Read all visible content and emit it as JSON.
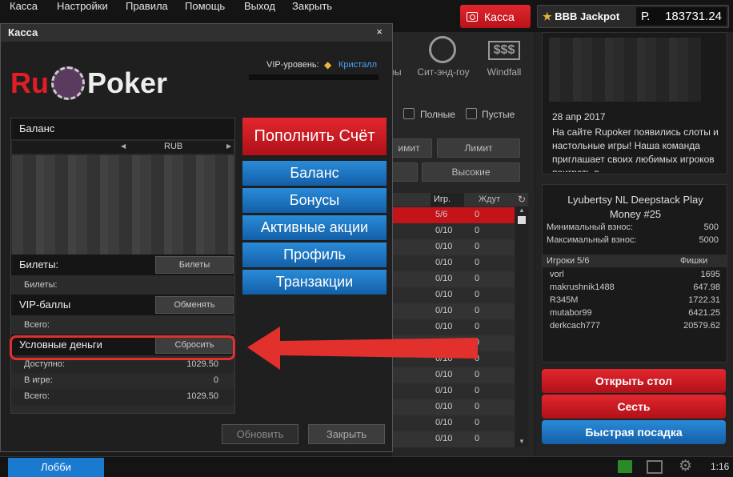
{
  "menu": [
    "Касса",
    "Настройки",
    "Правила",
    "Помощь",
    "Выход",
    "Закрыть"
  ],
  "cash_button": "Касса",
  "jackpot": {
    "title": "BBB Jackpot",
    "currency": "Р.",
    "value": "183731.24"
  },
  "game_tabs": [
    "ры",
    "Сит-энд-гоу",
    "Windfall"
  ],
  "filters": {
    "full": "Полные",
    "empty": "Пустые",
    "limit1": "имит",
    "limit2": "Лимит",
    "high": "Высокие"
  },
  "table_head": {
    "players": "Игр.",
    "waiting": "Ждут"
  },
  "table_rows": [
    {
      "players": "5/6",
      "wait": "0"
    },
    {
      "players": "0/10",
      "wait": "0"
    },
    {
      "players": "0/10",
      "wait": "0"
    },
    {
      "players": "0/10",
      "wait": "0"
    },
    {
      "players": "0/10",
      "wait": "0"
    },
    {
      "players": "0/10",
      "wait": "0"
    },
    {
      "players": "0/10",
      "wait": "0"
    },
    {
      "players": "0/10",
      "wait": "0"
    },
    {
      "players": "0/10",
      "wait": "0"
    },
    {
      "players": "0/10",
      "wait": "0"
    },
    {
      "players": "0/10",
      "wait": "0"
    },
    {
      "players": "0/10",
      "wait": "0"
    },
    {
      "players": "0/10",
      "wait": "0"
    },
    {
      "players": "0/10",
      "wait": "0"
    },
    {
      "players": "0/10",
      "wait": "0"
    }
  ],
  "window": {
    "title": "Касса",
    "close": "×",
    "logo": {
      "left": "Ru",
      "right": "Poker"
    },
    "vip": {
      "label": "VIP-уровень:",
      "value": "Кристалл"
    },
    "balance": {
      "heading": "Баланс",
      "currency": "RUB"
    },
    "tickets": {
      "heading": "Билеты:",
      "button": "Билеты",
      "label": "Билеты:"
    },
    "vip_points": {
      "heading": "VIP-баллы",
      "button": "Обменять",
      "label": "Всего:"
    },
    "play_money": {
      "heading": "Условные деньги",
      "button": "Сбросить",
      "rows": [
        {
          "label": "Доступно:",
          "value": "1029.50"
        },
        {
          "label": "В игре:",
          "value": "0"
        },
        {
          "label": "Всего:",
          "value": "1029.50"
        }
      ]
    },
    "deposit": "Пополнить Счёт",
    "nav": [
      "Баланс",
      "Бонусы",
      "Активные акции",
      "Профиль",
      "Транзакции"
    ],
    "refresh": "Обновить",
    "close_btn": "Закрыть"
  },
  "news": {
    "date": "28 апр 2017",
    "text": "На сайте Rupoker появились слоты и настольные игры! Наша команда приглашает своих любимых игроков поиграть в"
  },
  "table_info": {
    "title": "Lyubertsy NL Deepstack Play Money #25",
    "min_label": "Минимальный взнос:",
    "min": "500",
    "max_label": "Максимальный взнос:",
    "max": "5000",
    "players_head": "Игроки 5/6",
    "chips_head": "Фишки",
    "players": [
      {
        "name": "vorl",
        "chips": "1695"
      },
      {
        "name": "makrushnik1488",
        "chips": "647.98"
      },
      {
        "name": "R345M",
        "chips": "1722.31"
      },
      {
        "name": "mutabor99",
        "chips": "6421.25"
      },
      {
        "name": "derkcach777",
        "chips": "20579.62"
      }
    ]
  },
  "actions": {
    "open": "Открыть стол",
    "sit": "Сесть",
    "quick": "Быстрая посадка"
  },
  "status": {
    "lobby": "Лобби",
    "time": "1:16"
  }
}
